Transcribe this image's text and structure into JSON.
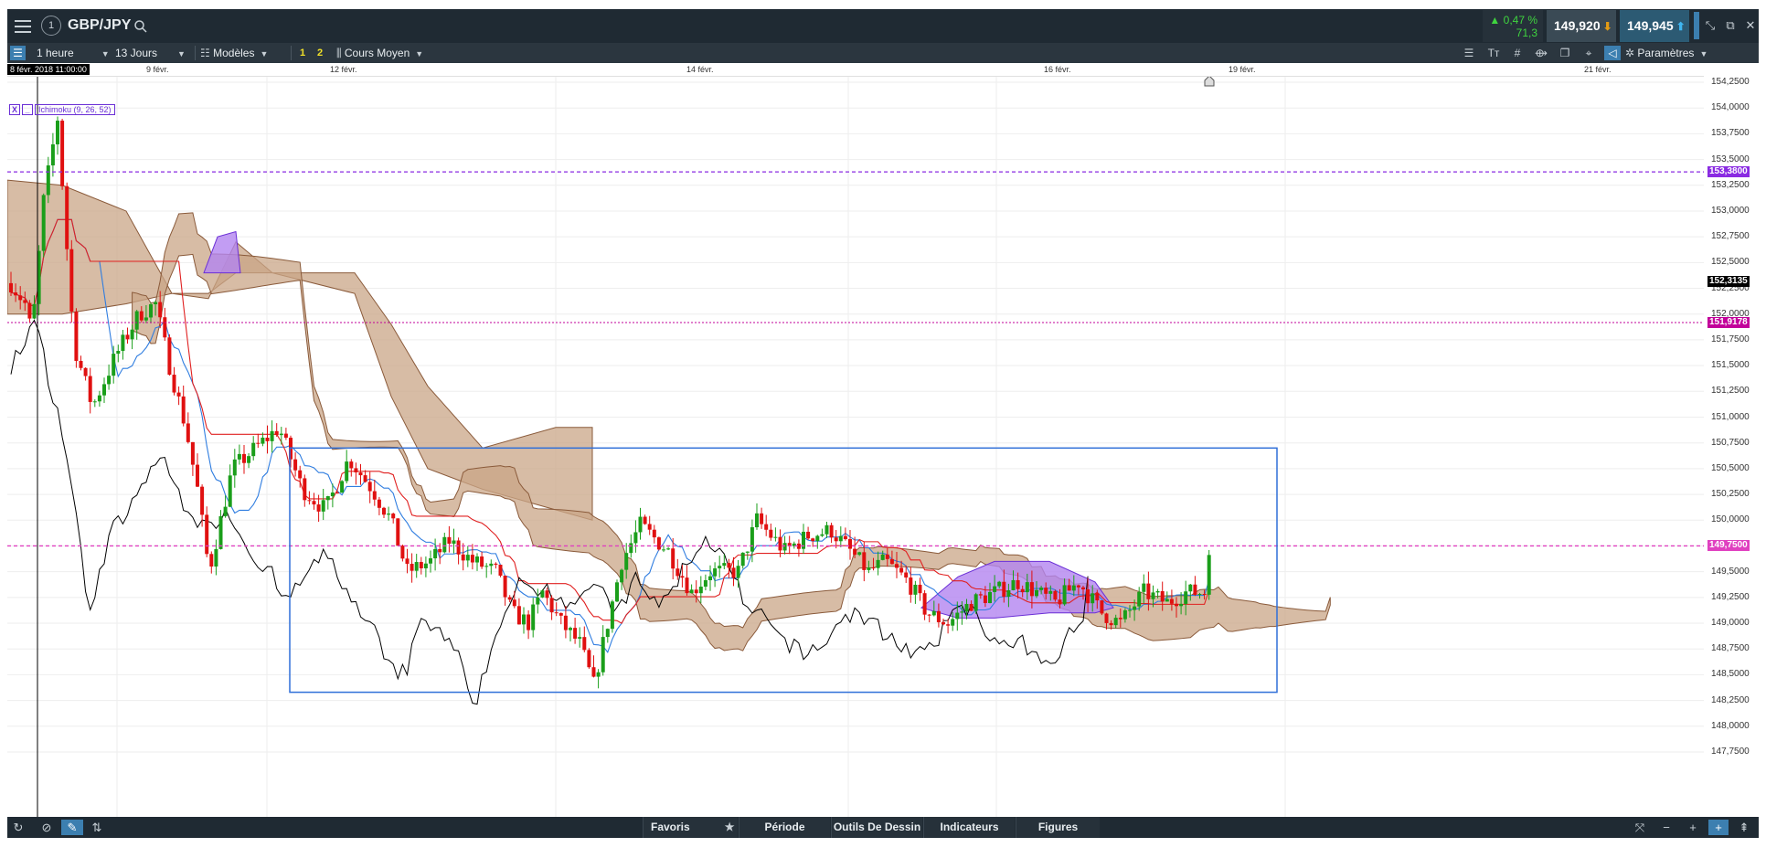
{
  "header": {
    "symbol": "GBP/JPY",
    "change_pct": "0,47 %",
    "change_pts": "71,3",
    "bid": "149,920",
    "ask": "149,945"
  },
  "toolbar": {
    "timeframe": "1 heure",
    "range": "13 Jours",
    "templates": "Modèles",
    "layout_1": "1",
    "layout_2": "2",
    "price_type": "Cours Moyen",
    "settings": "Paramètres"
  },
  "date_axis": {
    "cursor_date": "8 févr. 2018 11:00:00",
    "labels": [
      "9 févr.",
      "12 févr.",
      "14 févr.",
      "16 févr.",
      "19 févr.",
      "21 févr."
    ]
  },
  "indicator": {
    "close": "X",
    "minimize": "_",
    "name": "Ichimoku (9, 26, 52)"
  },
  "price_axis": {
    "labels": [
      "154,2500",
      "154,0000",
      "153,7500",
      "153,5000",
      "153,2500",
      "153,0000",
      "152,7500",
      "152,5000",
      "152,2500",
      "152,0000",
      "151,7500",
      "151,5000",
      "151,2500",
      "151,0000",
      "150,7500",
      "150,5000",
      "150,2500",
      "150,0000",
      "149,7500",
      "149,5000",
      "149,2500",
      "149,0000",
      "148,7500",
      "148,5000",
      "148,2500",
      "148,0000",
      "147,7500"
    ],
    "tags": [
      {
        "text": "153,3800",
        "color": "#8a2be2"
      },
      {
        "text": "152,3135",
        "color": "#000000"
      },
      {
        "text": "151,9178",
        "color": "#c2009a"
      },
      {
        "text": "149,7500",
        "color": "#e040c0"
      }
    ]
  },
  "bottom_bar": {
    "favorites": "Favoris",
    "period": "Période",
    "drawing_tools": "Outils De Dessin",
    "indicators": "Indicateurs",
    "figures": "Figures"
  },
  "colors": {
    "up_candle": "#1a9e1a",
    "down_candle": "#e01010",
    "cloud_bear": "#c9a587",
    "cloud_bull": "#b384f0",
    "tenkan": "#2f7de0",
    "kijun": "#e02020",
    "chikou": "#000000",
    "rect": "#2f6fd8"
  },
  "icons": [
    "menu-icon",
    "info-icon",
    "search-icon",
    "restore-icon",
    "popout-icon",
    "close-icon",
    "layers-icon",
    "text-size-icon",
    "grid-icon",
    "crosshair-icon",
    "copy-icon",
    "pin-icon",
    "tag-icon",
    "gear-icon",
    "refresh-icon",
    "cancel-icon",
    "pencil-icon",
    "swap-icon",
    "fit-icon",
    "zoom-out-icon",
    "zoom-in-icon",
    "crosshair-mode-icon",
    "pan-icon"
  ]
}
